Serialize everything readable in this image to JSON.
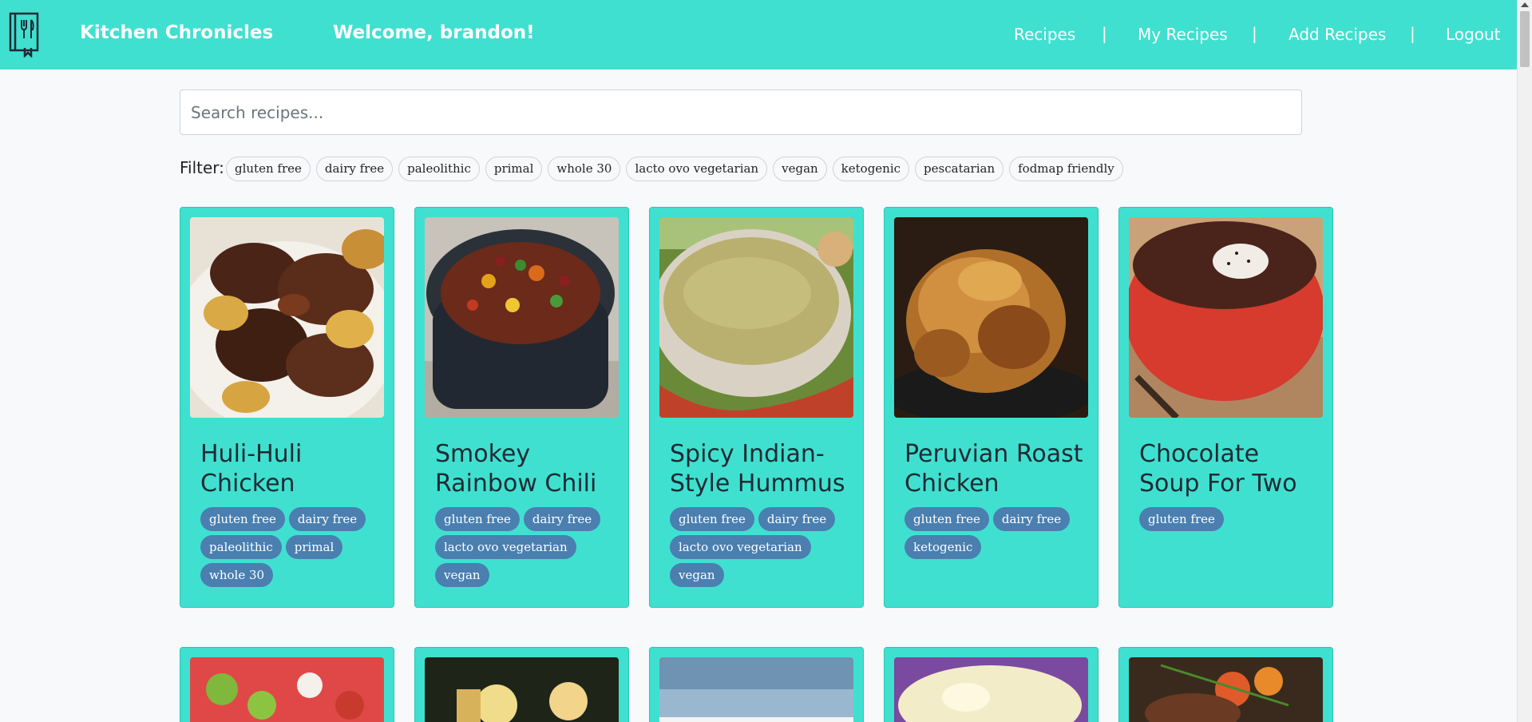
{
  "nav": {
    "brand": "Kitchen Chronicles",
    "welcome": "Welcome, brandon!",
    "links": [
      "Recipes",
      "My Recipes",
      "Add Recipes",
      "Logout"
    ],
    "separator": "|"
  },
  "search": {
    "placeholder": "Search recipes..."
  },
  "filter": {
    "label": "Filter:",
    "options": [
      "gluten free",
      "dairy free",
      "paleolithic",
      "primal",
      "whole 30",
      "lacto ovo vegetarian",
      "vegan",
      "ketogenic",
      "pescatarian",
      "fodmap friendly"
    ]
  },
  "recipes": [
    {
      "title": "Huli-Huli Chicken",
      "tags": [
        "gluten free",
        "dairy free",
        "paleolithic",
        "primal",
        "whole 30"
      ]
    },
    {
      "title": "Smokey Rainbow Chili",
      "tags": [
        "gluten free",
        "dairy free",
        "lacto ovo vegetarian",
        "vegan"
      ]
    },
    {
      "title": "Spicy Indian-Style Hummus",
      "tags": [
        "gluten free",
        "dairy free",
        "lacto ovo vegetarian",
        "vegan"
      ]
    },
    {
      "title": "Peruvian Roast Chicken",
      "tags": [
        "gluten free",
        "dairy free",
        "ketogenic"
      ]
    },
    {
      "title": "Chocolate Soup For Two",
      "tags": [
        "gluten free"
      ]
    }
  ],
  "colors": {
    "navbar": "#40e0d0",
    "card": "#40e0d0",
    "tag": "#4a7fb0"
  }
}
